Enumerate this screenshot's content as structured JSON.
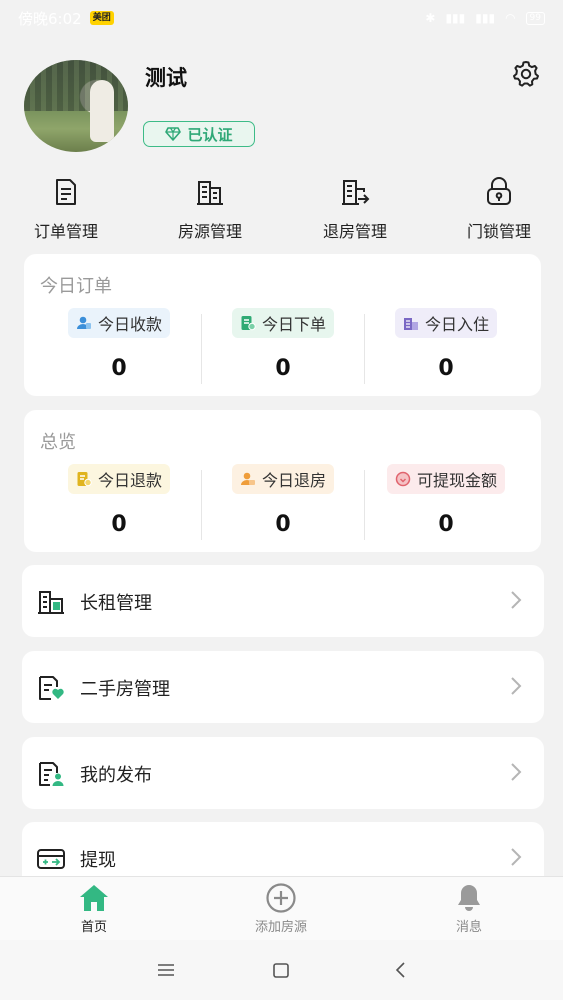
{
  "status_bar": {
    "time": "傍晚6:02",
    "app_badge": "美团",
    "battery": "99"
  },
  "profile": {
    "name": "测试",
    "cert_label": "已认证"
  },
  "quick_menu": [
    {
      "label": "订单管理",
      "icon": "order-icon"
    },
    {
      "label": "房源管理",
      "icon": "building-icon"
    },
    {
      "label": "退房管理",
      "icon": "checkout-icon"
    },
    {
      "label": "门锁管理",
      "icon": "lock-icon"
    }
  ],
  "today_orders": {
    "title": "今日订单",
    "stats": [
      {
        "label": "今日收款",
        "value": "0",
        "color": "#3b8fd9",
        "bg": "#eaf3fb"
      },
      {
        "label": "今日下单",
        "value": "0",
        "color": "#2faa74",
        "bg": "#e7f6ee"
      },
      {
        "label": "今日入住",
        "value": "0",
        "color": "#7a68c4",
        "bg": "#efedf9"
      }
    ]
  },
  "overview": {
    "title": "总览",
    "stats": [
      {
        "label": "今日退款",
        "value": "0",
        "color": "#e0b41f",
        "bg": "#fcf6df"
      },
      {
        "label": "今日退房",
        "value": "0",
        "color": "#ef9d3a",
        "bg": "#fdf1e2"
      },
      {
        "label": "可提现金额",
        "value": "0",
        "color": "#e0636d",
        "bg": "#fcebec"
      }
    ]
  },
  "menu_items": [
    {
      "label": "长租管理",
      "icon": "long-rent-icon"
    },
    {
      "label": "二手房管理",
      "icon": "second-hand-house-icon"
    },
    {
      "label": "我的发布",
      "icon": "my-publish-icon"
    },
    {
      "label": "提现",
      "icon": "withdraw-icon"
    }
  ],
  "tabbar": {
    "home": "首页",
    "add": "添加房源",
    "messages": "消息",
    "active_color": "#33b883",
    "inactive_color": "#8a8a8a"
  }
}
